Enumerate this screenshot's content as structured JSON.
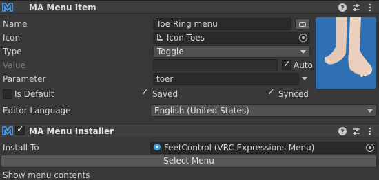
{
  "menu_item": {
    "title": "MA Menu Item",
    "fields": {
      "name_label": "Name",
      "name_value": "Toe Ring menu",
      "icon_label": "Icon",
      "icon_value": "Icon Toes",
      "type_label": "Type",
      "type_value": "Toggle",
      "value_label": "Value",
      "value_value": "",
      "auto_label": "Auto",
      "auto_checked": true,
      "parameter_label": "Parameter",
      "parameter_value": "toer"
    },
    "is_default_label": "Is Default",
    "is_default_checked": false,
    "saved_label": "Saved",
    "saved_checked": true,
    "synced_label": "Synced",
    "synced_checked": true,
    "editor_language_label": "Editor Language",
    "editor_language_value": "English (United States)"
  },
  "menu_installer": {
    "title": "MA Menu Installer",
    "enabled": true,
    "install_to_label": "Install To",
    "install_to_value": "FeetControl (VRC Expressions Menu)",
    "select_menu_label": "Select Menu",
    "show_contents_label": "Show menu contents"
  },
  "colors": {
    "background": "#383838",
    "field": "#2a2a2a",
    "preview_bg": "#2f6fb4",
    "logo_accent": "#4aa3ff"
  },
  "icons": [
    "help-icon",
    "settings-sliders-icon",
    "more-menu-icon",
    "object-picker-icon",
    "modular-avatar-logo-icon"
  ]
}
